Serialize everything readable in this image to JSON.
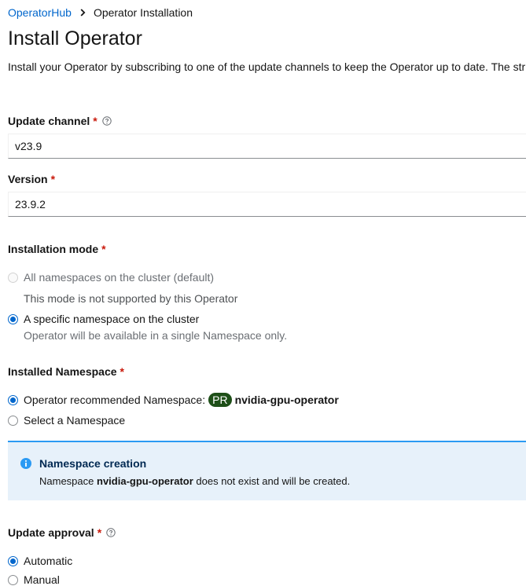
{
  "breadcrumb": {
    "parent": "OperatorHub",
    "current": "Operator Installation"
  },
  "page": {
    "title": "Install Operator",
    "description": "Install your Operator by subscribing to one of the update channels to keep the Operator up to date. The str"
  },
  "update_channel": {
    "label": "Update channel",
    "required_mark": "*",
    "value": "v23.9"
  },
  "version": {
    "label": "Version",
    "required_mark": "*",
    "value": "23.9.2"
  },
  "installation_mode": {
    "label": "Installation mode",
    "required_mark": "*",
    "options": [
      {
        "label": "All namespaces on the cluster (default)",
        "helper": "This mode is not supported by this Operator",
        "state": "disabled"
      },
      {
        "label": "A specific namespace on the cluster",
        "helper": "Operator will be available in a single Namespace only.",
        "state": "selected"
      }
    ]
  },
  "installed_namespace": {
    "label": "Installed Namespace",
    "required_mark": "*",
    "recommended_label": "Operator recommended Namespace:",
    "badge": "PR",
    "namespace": "nvidia-gpu-operator",
    "select_label": "Select a Namespace"
  },
  "alert": {
    "title": "Namespace creation",
    "body_prefix": "Namespace",
    "body_namespace": "nvidia-gpu-operator",
    "body_suffix": "does not exist and will be created."
  },
  "update_approval": {
    "label": "Update approval",
    "required_mark": "*",
    "options": [
      {
        "label": "Automatic",
        "state": "selected"
      },
      {
        "label": "Manual",
        "state": "unselected"
      }
    ]
  },
  "colors": {
    "link": "#0066cc",
    "required": "#c9190b",
    "alert_bg": "#e7f1fa",
    "alert_border": "#2b9af3",
    "badge": "#1e4f18"
  }
}
